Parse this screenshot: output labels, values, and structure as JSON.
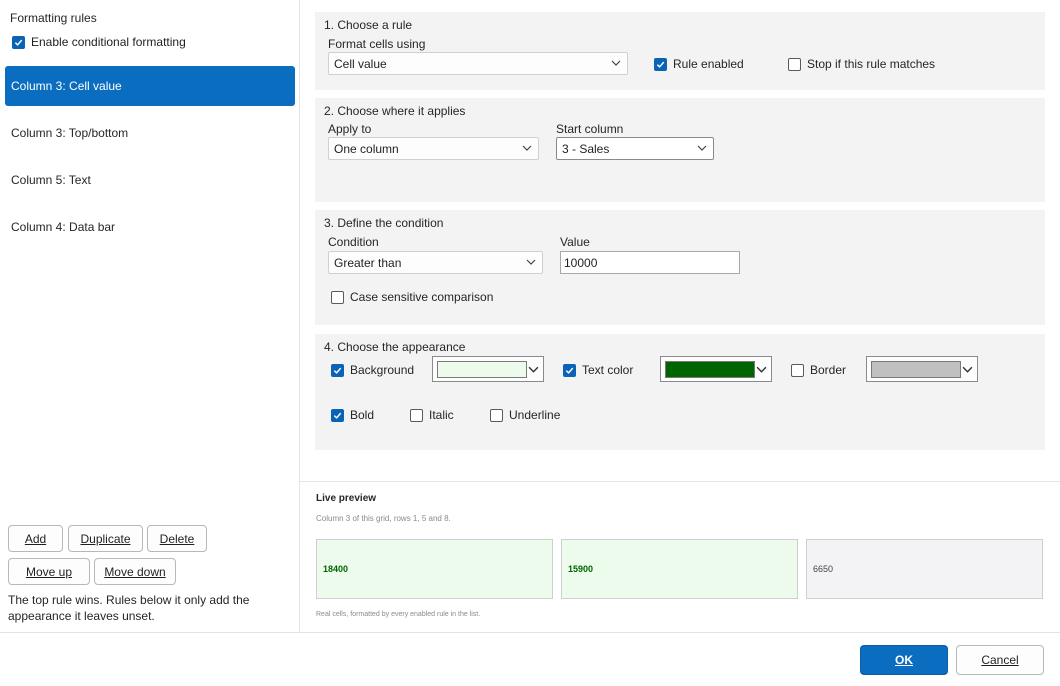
{
  "sidebar": {
    "title": "Formatting rules",
    "enable_label": "Enable conditional formatting",
    "enable_checked": true,
    "rules": [
      {
        "label": "Column 3: Cell value",
        "selected": true
      },
      {
        "label": "Column 3: Top/bottom",
        "selected": false
      },
      {
        "label": "Column 5: Text",
        "selected": false
      },
      {
        "label": "Column 4: Data bar",
        "selected": false
      }
    ],
    "buttons": {
      "add": "Add",
      "duplicate": "Duplicate",
      "delete": "Delete",
      "move_up": "Move up",
      "move_down": "Move down"
    },
    "hint": "The top rule wins. Rules below it only add the appearance it leaves unset."
  },
  "rule": {
    "title": "1. Choose a rule",
    "format_label": "Format cells using",
    "format_value": "Cell value",
    "rule_enabled_label": "Rule enabled",
    "rule_enabled_checked": true,
    "stop_label": "Stop if this rule matches",
    "stop_checked": false
  },
  "applies": {
    "title": "2. Choose where it applies",
    "apply_label": "Apply to",
    "apply_value": "One column",
    "start_label": "Start column",
    "start_value": "3 - Sales"
  },
  "condition": {
    "title": "3. Define the condition",
    "condition_label": "Condition",
    "condition_value": "Greater than",
    "value_label": "Value",
    "value": "10000",
    "case_label": "Case sensitive comparison",
    "case_checked": false
  },
  "appearance": {
    "title": "4. Choose the appearance",
    "background_label": "Background",
    "background_checked": true,
    "background_color": "#ecfbec",
    "text_color_label": "Text color",
    "text_color_checked": true,
    "text_color": "#006400",
    "border_label": "Border",
    "border_checked": false,
    "border_color": "#c0c0c0",
    "bold_label": "Bold",
    "bold_checked": true,
    "italic_label": "Italic",
    "italic_checked": false,
    "underline_label": "Underline",
    "underline_checked": false
  },
  "preview": {
    "title": "Live preview",
    "subtitle": "Column 3 of this grid, rows 1, 5 and 8.",
    "cells": [
      {
        "value": "18400",
        "formatted": true
      },
      {
        "value": "15900",
        "formatted": true
      },
      {
        "value": "6650",
        "formatted": false
      }
    ],
    "footnote": "Real cells, formatted by every enabled rule in the list."
  },
  "footer": {
    "ok": "OK",
    "cancel": "Cancel"
  },
  "colors": {
    "accent": "#0a6dbf",
    "panel_bg": "#f3f3f3",
    "unformatted_cell_bg": "#f3f3f5"
  }
}
